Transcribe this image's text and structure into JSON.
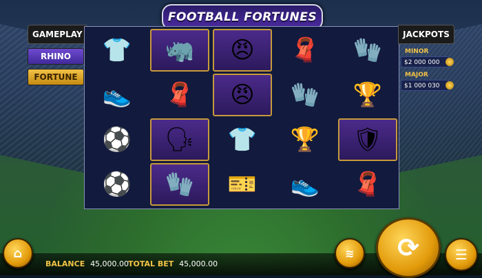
{
  "game": {
    "title": "FOOTBALL FORTUNES"
  },
  "side_panel": {
    "title": "GAMEPLAY",
    "modes": [
      {
        "label": "RHINO",
        "state": "inactive"
      },
      {
        "label": "FORTUNE",
        "state": "active"
      }
    ]
  },
  "jackpots": {
    "title": "JACKPOTS",
    "items": [
      {
        "label": "MINOR",
        "value": "$2 000 000"
      },
      {
        "label": "MAJOR",
        "value": "$1 000 030"
      }
    ]
  },
  "reels": [
    [
      "jersey-icon",
      "cleat-icon",
      "football-icon",
      "football-icon"
    ],
    [
      "rhino-icon",
      "scarf-icon",
      "referee-icon",
      "goalkeeper-icon"
    ],
    [
      "player-shouting-icon",
      "player-shouting-icon",
      "jersey-icon",
      "ticket-card-icon"
    ],
    [
      "scarf-icon",
      "gloves-icon",
      "trophy-icon",
      "cleat-icon"
    ],
    [
      "gloves-icon",
      "trophy-icon",
      "badge-icon",
      "scarf-icon"
    ]
  ],
  "status": {
    "balance_label": "BALANCE",
    "balance_value": "45,000.00",
    "total_bet_label": "TOTAL BET",
    "total_bet_value": "45,000.00"
  },
  "colors": {
    "accent_gold": "#f2c247",
    "accent_purple": "#5a36b8"
  }
}
